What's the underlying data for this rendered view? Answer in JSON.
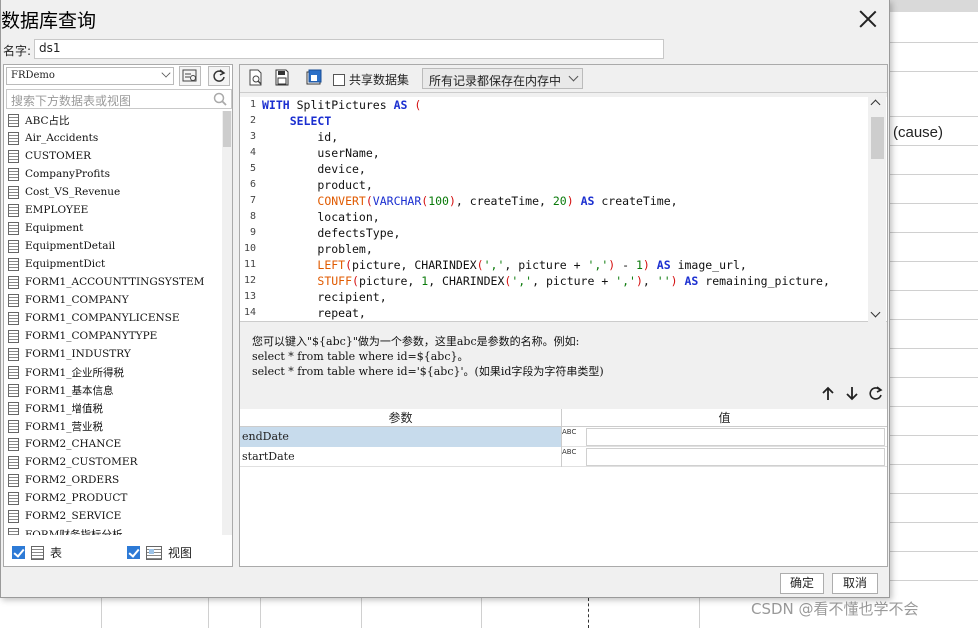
{
  "dialog": {
    "title": "数据库查询",
    "name_label": "名字:",
    "name_value": "ds1",
    "ok_label": "确定",
    "cancel_label": "取消"
  },
  "left": {
    "connection": "FRDemo",
    "search_placeholder": "搜索下方数据表或视图",
    "tables": [
      "ABC占比",
      "Air_Accidents",
      "CUSTOMER",
      "CompanyProfits",
      "Cost_VS_Revenue",
      "EMPLOYEE",
      "Equipment",
      "EquipmentDetail",
      "EquipmentDict",
      "FORM1_ACCOUNTTINGSYSTEM",
      "FORM1_COMPANY",
      "FORM1_COMPANYLICENSE",
      "FORM1_COMPANYTYPE",
      "FORM1_INDUSTRY",
      "FORM1_企业所得税",
      "FORM1_基本信息",
      "FORM1_增值税",
      "FORM1_营业税",
      "FORM2_CHANCE",
      "FORM2_CUSTOMER",
      "FORM2_ORDERS",
      "FORM2_PRODUCT",
      "FORM2_SERVICE",
      "FORM财务指标分析"
    ],
    "show_tables_label": "表",
    "show_views_label": "视图"
  },
  "toolbar": {
    "shared_dataset_label": "共享数据集",
    "storage_option": "所有记录都保存在内存中"
  },
  "sql_lines": [
    "WITH SplitPictures AS (",
    "    SELECT",
    "        id,",
    "        userName,",
    "        device,",
    "        product,",
    "        CONVERT(VARCHAR(100), createTime, 20) AS createTime,",
    "        location,",
    "        defectsType,",
    "        problem,",
    "        LEFT(picture, CHARINDEX(',', picture + ',') - 1) AS image_url,",
    "        STUFF(picture, 1, CHARINDEX(',', picture + ','), '') AS remaining_picture,",
    "        recipient,",
    "        repeat,"
  ],
  "hint": {
    "line1": "您可以键入\"${abc}\"做为一个参数，这里abc是参数的名称。例如:",
    "line2": "select * from table where id=${abc}。",
    "line3": "select * from table where id='${abc}'。(如果id字段为字符串类型)"
  },
  "params": {
    "col_name": "参数",
    "col_value": "值",
    "type_label": "ABC",
    "rows": [
      {
        "name": "endDate",
        "value": ""
      },
      {
        "name": "startDate",
        "value": ""
      }
    ]
  },
  "background": {
    "cell_text": "(cause)",
    "watermark": "CSDN @看不懂也学不会"
  }
}
